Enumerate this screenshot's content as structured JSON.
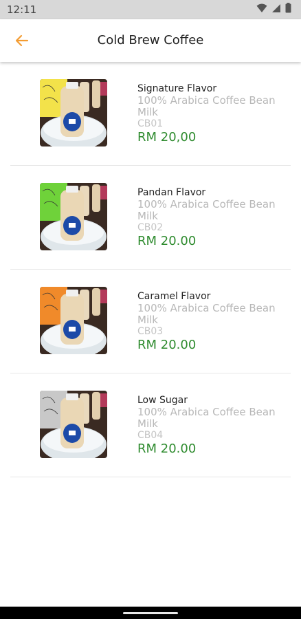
{
  "status_bar": {
    "time": "12:11",
    "icons": [
      "wifi-icon",
      "signal-icon",
      "battery-icon"
    ]
  },
  "app_bar": {
    "title": "Cold Brew Coffee",
    "back_icon": "arrow-left-icon",
    "accent_color": "#f39c32"
  },
  "products": [
    {
      "name": "Signature Flavor",
      "description": "100% Arabica Coffee Bean Milk",
      "code": "CB01",
      "price": "RM 20,00",
      "thumb_color": "#f3e24a"
    },
    {
      "name": "Pandan Flavor",
      "description": "100% Arabica Coffee Bean Milk",
      "code": "CB02",
      "price": "RM 20.00",
      "thumb_color": "#6fd23a"
    },
    {
      "name": "Caramel Flavor",
      "description": "100% Arabica Coffee Bean Milk",
      "code": "CB03",
      "price": "RM 20.00",
      "thumb_color": "#f08a2a"
    },
    {
      "name": "Low Sugar",
      "description": "100% Arabica Coffee Bean Milk",
      "code": "CB04",
      "price": "RM 20.00",
      "thumb_color": "#c8c8c8"
    }
  ],
  "colors": {
    "price": "#2e8b2e",
    "secondary_text": "#b8b8b8"
  }
}
